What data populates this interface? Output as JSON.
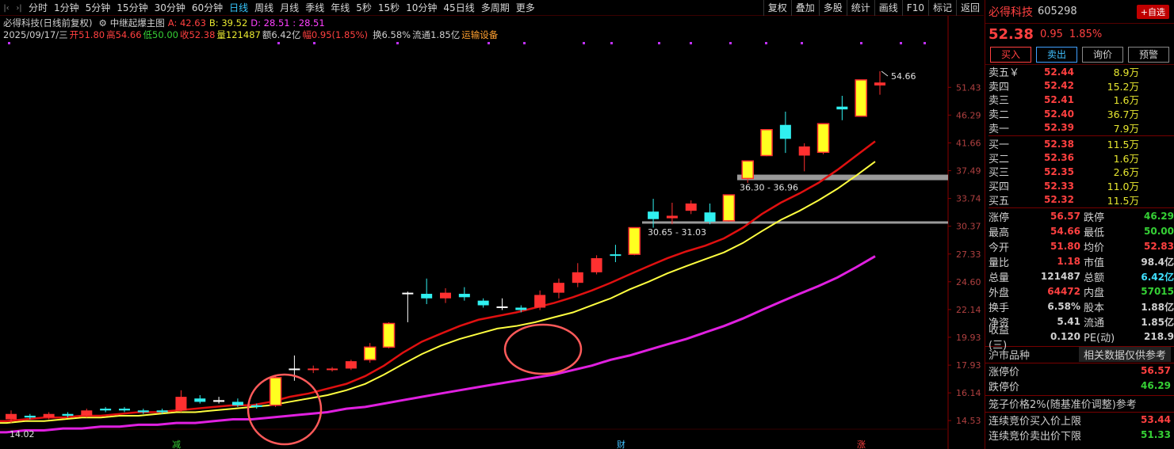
{
  "toolbar": {
    "periods": [
      "分时",
      "1分钟",
      "5分钟",
      "15分钟",
      "30分钟",
      "60分钟",
      "日线",
      "周线",
      "月线",
      "季线",
      "年线",
      "5秒",
      "15秒",
      "10分钟",
      "45日线",
      "多周期",
      "更多"
    ],
    "active_period": "日线",
    "tools": [
      "复权",
      "叠加",
      "多股",
      "统计",
      "画线",
      "F10",
      "标记",
      "返回"
    ]
  },
  "info": {
    "title": "必得科技(日线前复权)",
    "indicator": "中继起爆主图",
    "a_label": "A: 42.63",
    "b_label": "B: 39.52",
    "d_label": "D: 28.51 : 28.51",
    "date": "2025/09/17/三",
    "open": "开51.80",
    "high": "高54.66",
    "low": "低50.00",
    "close": "收52.38",
    "volume": "量121487",
    "amount": "额6.42亿",
    "range": "幅0.95(1.85%)",
    "turnover": "换6.58%",
    "float": "流通1.85亿",
    "sector": "运输设备"
  },
  "chart_data": {
    "type": "candlestick",
    "y_axis_labels": [
      "51.43",
      "46.29",
      "41.66",
      "37.49",
      "33.74",
      "30.37",
      "27.33",
      "24.60",
      "22.14",
      "19.93",
      "17.93",
      "16.14",
      "14.53"
    ],
    "high_label": "54.66",
    "low_label": "14.02",
    "zone_labels": [
      "36.30 - 36.96",
      "30.65 - 31.03"
    ],
    "bottom_markers": [
      "减",
      "财",
      "涨"
    ],
    "candles": [
      {
        "o": 14.6,
        "c": 14.9,
        "h": 15.1,
        "l": 14.4,
        "t": "r"
      },
      {
        "o": 14.8,
        "c": 14.7,
        "h": 14.9,
        "l": 14.6,
        "t": "c"
      },
      {
        "o": 14.7,
        "c": 14.9,
        "h": 15.0,
        "l": 14.6,
        "t": "r"
      },
      {
        "o": 14.9,
        "c": 14.8,
        "h": 15.0,
        "l": 14.7,
        "t": "c"
      },
      {
        "o": 14.8,
        "c": 15.1,
        "h": 15.2,
        "l": 14.7,
        "t": "r"
      },
      {
        "o": 15.1,
        "c": 15.2,
        "h": 15.3,
        "l": 15.0,
        "t": "c"
      },
      {
        "o": 15.2,
        "c": 15.1,
        "h": 15.3,
        "l": 15.0,
        "t": "c"
      },
      {
        "o": 15.1,
        "c": 15.0,
        "h": 15.2,
        "l": 14.9,
        "t": "c"
      },
      {
        "o": 15.0,
        "c": 15.1,
        "h": 15.2,
        "l": 14.9,
        "t": "c"
      },
      {
        "o": 15.1,
        "c": 15.9,
        "h": 16.3,
        "l": 15.0,
        "t": "r"
      },
      {
        "o": 15.8,
        "c": 15.6,
        "h": 16.0,
        "l": 15.5,
        "t": "c"
      },
      {
        "o": 15.6,
        "c": 15.7,
        "h": 15.9,
        "l": 15.5,
        "t": "w"
      },
      {
        "o": 15.6,
        "c": 15.4,
        "h": 15.8,
        "l": 15.3,
        "t": "c"
      },
      {
        "o": 15.3,
        "c": 15.4,
        "h": 15.5,
        "l": 15.2,
        "t": "c"
      },
      {
        "o": 15.4,
        "c": 17.1,
        "h": 17.2,
        "l": 15.3,
        "t": "y"
      },
      {
        "o": 17.7,
        "c": 17.7,
        "h": 18.6,
        "l": 16.9,
        "t": "w"
      },
      {
        "o": 17.6,
        "c": 17.7,
        "h": 17.9,
        "l": 17.4,
        "t": "r"
      },
      {
        "o": 17.6,
        "c": 17.7,
        "h": 17.8,
        "l": 17.5,
        "t": "r"
      },
      {
        "o": 17.7,
        "c": 18.2,
        "h": 18.3,
        "l": 17.6,
        "t": "r"
      },
      {
        "o": 18.3,
        "c": 19.2,
        "h": 19.5,
        "l": 18.1,
        "t": "y"
      },
      {
        "o": 19.2,
        "c": 21.0,
        "h": 21.1,
        "l": 19.1,
        "t": "y"
      },
      {
        "o": 23.6,
        "c": 23.6,
        "h": 23.7,
        "l": 21.1,
        "t": "w"
      },
      {
        "o": 23.5,
        "c": 23.1,
        "h": 24.9,
        "l": 22.6,
        "t": "c"
      },
      {
        "o": 23.1,
        "c": 23.6,
        "h": 24.0,
        "l": 22.7,
        "t": "r"
      },
      {
        "o": 23.5,
        "c": 23.2,
        "h": 24.1,
        "l": 22.9,
        "t": "c"
      },
      {
        "o": 22.9,
        "c": 22.5,
        "h": 23.1,
        "l": 22.3,
        "t": "c"
      },
      {
        "o": 22.4,
        "c": 22.4,
        "h": 23.1,
        "l": 22.1,
        "t": "w"
      },
      {
        "o": 22.3,
        "c": 22.1,
        "h": 22.5,
        "l": 21.9,
        "t": "c"
      },
      {
        "o": 22.3,
        "c": 23.4,
        "h": 23.8,
        "l": 22.1,
        "t": "r"
      },
      {
        "o": 23.6,
        "c": 24.5,
        "h": 24.9,
        "l": 23.1,
        "t": "r"
      },
      {
        "o": 24.5,
        "c": 25.5,
        "h": 26.4,
        "l": 24.1,
        "t": "r"
      },
      {
        "o": 25.5,
        "c": 26.9,
        "h": 27.2,
        "l": 25.3,
        "t": "r"
      },
      {
        "o": 27.2,
        "c": 27.3,
        "h": 28.3,
        "l": 26.5,
        "t": "c"
      },
      {
        "o": 27.3,
        "c": 30.2,
        "h": 30.2,
        "l": 27.2,
        "t": "y"
      },
      {
        "o": 32.1,
        "c": 31.2,
        "h": 33.7,
        "l": 30.2,
        "t": "c"
      },
      {
        "o": 31.3,
        "c": 31.6,
        "h": 33.2,
        "l": 30.6,
        "t": "r"
      },
      {
        "o": 32.2,
        "c": 33.1,
        "h": 33.5,
        "l": 31.8,
        "t": "r"
      },
      {
        "o": 32.0,
        "c": 30.9,
        "h": 33.1,
        "l": 30.6,
        "t": "c"
      },
      {
        "o": 31.0,
        "c": 34.2,
        "h": 34.2,
        "l": 30.9,
        "t": "y"
      },
      {
        "o": 36.4,
        "c": 38.9,
        "h": 38.9,
        "l": 35.8,
        "t": "y"
      },
      {
        "o": 39.7,
        "c": 43.8,
        "h": 43.8,
        "l": 39.6,
        "t": "y"
      },
      {
        "o": 44.6,
        "c": 42.3,
        "h": 46.9,
        "l": 40.1,
        "t": "c"
      },
      {
        "o": 41.1,
        "c": 39.7,
        "h": 41.6,
        "l": 37.4,
        "t": "r"
      },
      {
        "o": 40.2,
        "c": 44.8,
        "h": 44.8,
        "l": 39.9,
        "t": "y"
      },
      {
        "o": 47.3,
        "c": 47.8,
        "h": 49.8,
        "l": 45.4,
        "t": "c"
      },
      {
        "o": 46.1,
        "c": 52.9,
        "h": 52.9,
        "l": 46.0,
        "t": "y"
      },
      {
        "o": 51.8,
        "c": 52.38,
        "h": 54.66,
        "l": 50.0,
        "t": "r"
      }
    ],
    "ma_red": [
      14.5,
      14.6,
      14.7,
      14.7,
      14.8,
      14.8,
      14.9,
      15.0,
      15.0,
      15.1,
      15.2,
      15.3,
      15.4,
      15.4,
      15.6,
      15.9,
      16.1,
      16.4,
      16.7,
      17.2,
      17.9,
      18.8,
      19.6,
      20.2,
      20.8,
      21.3,
      21.6,
      21.9,
      22.3,
      22.7,
      23.2,
      23.8,
      24.5,
      25.3,
      26.1,
      26.9,
      27.6,
      28.2,
      29.0,
      30.2,
      31.8,
      33.2,
      34.4,
      35.8,
      37.6,
      39.7,
      41.9
    ],
    "ma_yellow": [
      14.4,
      14.5,
      14.5,
      14.6,
      14.7,
      14.7,
      14.8,
      14.8,
      14.9,
      15.0,
      15.0,
      15.1,
      15.2,
      15.3,
      15.4,
      15.6,
      15.8,
      16.0,
      16.3,
      16.7,
      17.3,
      18.0,
      18.7,
      19.3,
      19.8,
      20.2,
      20.6,
      20.8,
      21.1,
      21.5,
      21.9,
      22.5,
      23.1,
      23.9,
      24.6,
      25.4,
      26.1,
      26.8,
      27.5,
      28.5,
      29.8,
      31.1,
      32.2,
      33.5,
      35.0,
      36.8,
      38.8
    ],
    "ma_magenta": [
      13.9,
      14.0,
      14.0,
      14.1,
      14.1,
      14.2,
      14.2,
      14.3,
      14.3,
      14.4,
      14.4,
      14.5,
      14.6,
      14.6,
      14.7,
      14.8,
      14.9,
      15.0,
      15.2,
      15.3,
      15.5,
      15.7,
      15.9,
      16.1,
      16.3,
      16.5,
      16.7,
      16.9,
      17.1,
      17.3,
      17.6,
      17.9,
      18.3,
      18.6,
      19.0,
      19.4,
      19.8,
      20.3,
      20.8,
      21.4,
      22.1,
      22.8,
      23.5,
      24.2,
      25.0,
      26.0,
      27.1
    ]
  },
  "panel": {
    "name": "必得科技",
    "code": "605298",
    "add_label": "+自选",
    "price": "52.38",
    "change": "0.95",
    "change_pct": "1.85%",
    "buttons": [
      "买入",
      "卖出",
      "询价",
      "预警"
    ],
    "sells": [
      {
        "label": "卖五￥",
        "price": "52.44",
        "vol": "8.9万"
      },
      {
        "label": "卖四",
        "price": "52.42",
        "vol": "15.2万"
      },
      {
        "label": "卖三",
        "price": "52.41",
        "vol": "1.6万"
      },
      {
        "label": "卖二",
        "price": "52.40",
        "vol": "36.7万"
      },
      {
        "label": "卖一",
        "price": "52.39",
        "vol": "7.9万"
      }
    ],
    "buys": [
      {
        "label": "买一",
        "price": "52.38",
        "vol": "11.5万"
      },
      {
        "label": "买二",
        "price": "52.36",
        "vol": "1.6万"
      },
      {
        "label": "买三",
        "price": "52.35",
        "vol": "2.6万"
      },
      {
        "label": "买四",
        "price": "52.33",
        "vol": "11.0万"
      },
      {
        "label": "买五",
        "price": "52.32",
        "vol": "11.5万"
      }
    ],
    "quotes": [
      {
        "k": "涨停",
        "v": "56.57",
        "vc": "r",
        "k2": "跌停",
        "v2": "46.29",
        "v2c": "g"
      },
      {
        "k": "最高",
        "v": "54.66",
        "vc": "r",
        "k2": "最低",
        "v2": "50.00",
        "v2c": "g"
      },
      {
        "k": "今开",
        "v": "51.80",
        "vc": "r",
        "k2": "均价",
        "v2": "52.83",
        "v2c": "r"
      },
      {
        "k": "量比",
        "v": "1.18",
        "vc": "r",
        "k2": "市值",
        "v2": "98.4亿",
        "v2c": "w"
      },
      {
        "k": "总量",
        "v": "121487",
        "vc": "w",
        "k2": "总额",
        "v2": "6.42亿",
        "v2c": "c"
      },
      {
        "k": "外盘",
        "v": "64472",
        "vc": "r",
        "k2": "内盘",
        "v2": "57015",
        "v2c": "g"
      },
      {
        "k": "换手",
        "v": "6.58%",
        "vc": "w",
        "k2": "股本",
        "v2": "1.88亿",
        "v2c": "w"
      },
      {
        "k": "净资",
        "v": "5.41",
        "vc": "w",
        "k2": "流通",
        "v2": "1.85亿",
        "v2c": "w"
      },
      {
        "k": "收益(三)",
        "v": "0.120",
        "vc": "w",
        "k2": "PE(动)",
        "v2": "218.9",
        "v2c": "w"
      }
    ],
    "market_type": "沪市品种",
    "note": "相关数据仅供参考",
    "limits": [
      {
        "k": "涨停价",
        "v": "56.57",
        "vc": "r"
      },
      {
        "k": "跌停价",
        "v": "46.29",
        "vc": "g"
      }
    ],
    "cage_title": "笼子价格2%(随基准价调整)参考",
    "cage": [
      {
        "k": "连续竞价买入价上限",
        "v": "53.44",
        "vc": "r"
      },
      {
        "k": "连续竞价卖出价下限",
        "v": "51.33",
        "vc": "g"
      }
    ]
  }
}
